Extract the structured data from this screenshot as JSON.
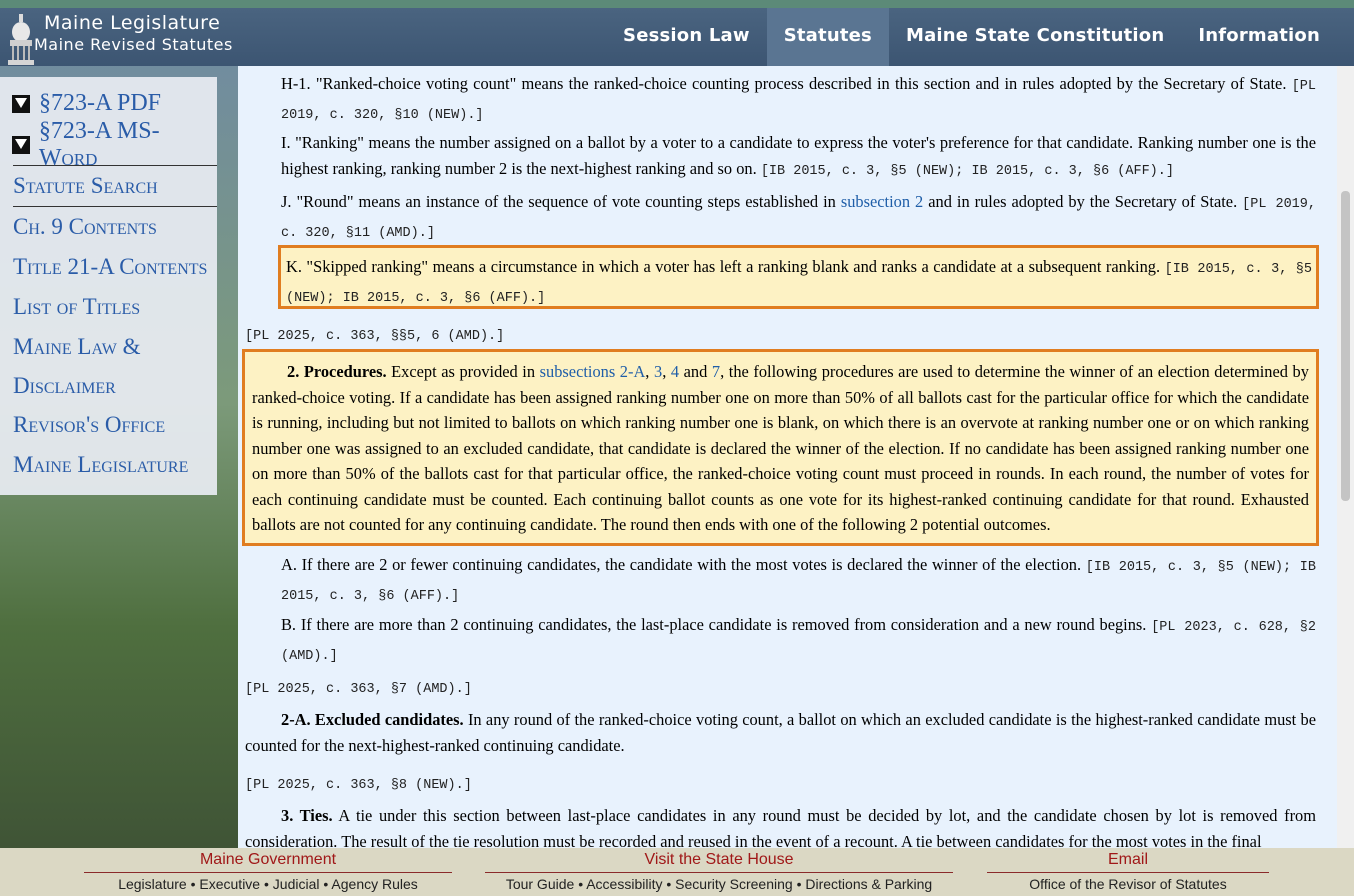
{
  "header": {
    "title": "Maine Legislature",
    "subtitle": "Maine Revised Statutes",
    "nav": [
      "Session Law",
      "Statutes",
      "Maine State Constitution",
      "Information"
    ]
  },
  "sidebar": {
    "downloads": [
      "§723-A PDF",
      "§723-A MS-Word"
    ],
    "links": [
      "Statute Search",
      "Ch. 9 Contents",
      "Title 21-A Contents",
      "List of Titles",
      "Maine Law &",
      "Disclaimer",
      "Revisor's Office",
      "Maine Legislature"
    ]
  },
  "content": {
    "h1_text": "H-1. \"Ranked-choice voting count\" means the ranked-choice counting process described in this section and in rules adopted by the Secretary of State.",
    "h1_cite": "[PL 2019, c. 320, §10 (NEW).]",
    "i_text": "I. \"Ranking\" means the number assigned on a ballot by a voter to a candidate to express the voter's preference for that candidate. Ranking number one is the highest ranking, ranking number 2 is the next-highest ranking and so on.",
    "i_cite": "[IB 2015, c. 3, §5 (NEW); IB 2015, c. 3, §6 (AFF).]",
    "j_text_a": "J. \"Round\" means an instance of the sequence of vote counting steps established in",
    "j_link": "subsection 2",
    "j_text_b": "and in rules adopted by the Secretary of State.",
    "j_cite": "[PL 2019, c. 320, §11 (AMD).]",
    "k_text": "K. \"Skipped ranking\" means a circumstance in which a voter has left a ranking blank and ranks a candidate at a subsequent ranking.",
    "k_cite": "[IB 2015, c. 3, §5 (NEW); IB 2015, c. 3, §6 (AFF).]",
    "cite1": "[PL 2025, c. 363, §§5, 6 (AMD).]",
    "s2_head": "2. Procedures.",
    "s2_a": "Except as provided in",
    "s2_link1": "subsections 2-A",
    "s2_comma": ",",
    "s2_link2": "3",
    "s2_link3": "4",
    "s2_and": "and",
    "s2_link4": "7",
    "s2_b": ", the following procedures are used to determine the winner of an election determined by ranked-choice voting. If a candidate has been assigned ranking number one on more than 50% of all ballots cast for the particular office for which the candidate is running, including but not limited to ballots on which ranking number one is blank, on which there is an overvote at ranking number one or on which ranking number one was assigned to an excluded candidate, that candidate is declared the winner of the election. If no candidate has been assigned ranking number one on more than 50% of the ballots cast for that particular office, the ranked-choice voting count must proceed in rounds. In each round, the number of votes for each continuing candidate must be counted. Each continuing ballot counts as one vote for its highest-ranked continuing candidate for that round. Exhausted ballots are not counted for any continuing candidate. The round then ends with one of the following 2 potential outcomes.",
    "a_text": "A. If there are 2 or fewer continuing candidates, the candidate with the most votes is declared the winner of the election.",
    "a_cite": "[IB 2015, c. 3, §5 (NEW); IB 2015, c. 3, §6 (AFF).]",
    "b_text": "B. If there are more than 2 continuing candidates, the last-place candidate is removed from consideration and a new round begins.",
    "b_cite": "[PL 2023, c. 628, §2 (AMD).]",
    "cite2": "[PL 2025, c. 363, §7 (AMD).]",
    "s2a_head": "2-A. Excluded candidates.",
    "s2a_text": "In any round of the ranked-choice voting count, a ballot on which an excluded candidate is the highest-ranked candidate must be counted for the next-highest-ranked continuing candidate.",
    "cite3": "[PL 2025, c. 363, §8 (NEW).]",
    "s3_head": "3. Ties.",
    "s3_text": "A tie under this section between last-place candidates in any round must be decided by lot, and the candidate chosen by lot is removed from consideration. The result of the tie resolution must be recorded and reused in the event of a recount. A tie between candidates for the most votes in the final"
  },
  "footer": {
    "col1_head": "Maine Government",
    "col1_links": [
      "Legislature",
      "Executive",
      "Judicial",
      "Agency Rules"
    ],
    "col2_head": "Visit the State House",
    "col2_links": [
      "Tour Guide",
      "Accessibility",
      "Security Screening",
      "Directions & Parking"
    ],
    "col3_head": "Email",
    "col3_sub": "Office of the Revisor of Statutes",
    "sep": "•"
  },
  "colors": {
    "header_bg": "#3c5572",
    "link": "#1f5ea8",
    "highlight_bg": "#fdf2c4",
    "highlight_border": "#e07d20",
    "footer_head": "#a01818"
  }
}
